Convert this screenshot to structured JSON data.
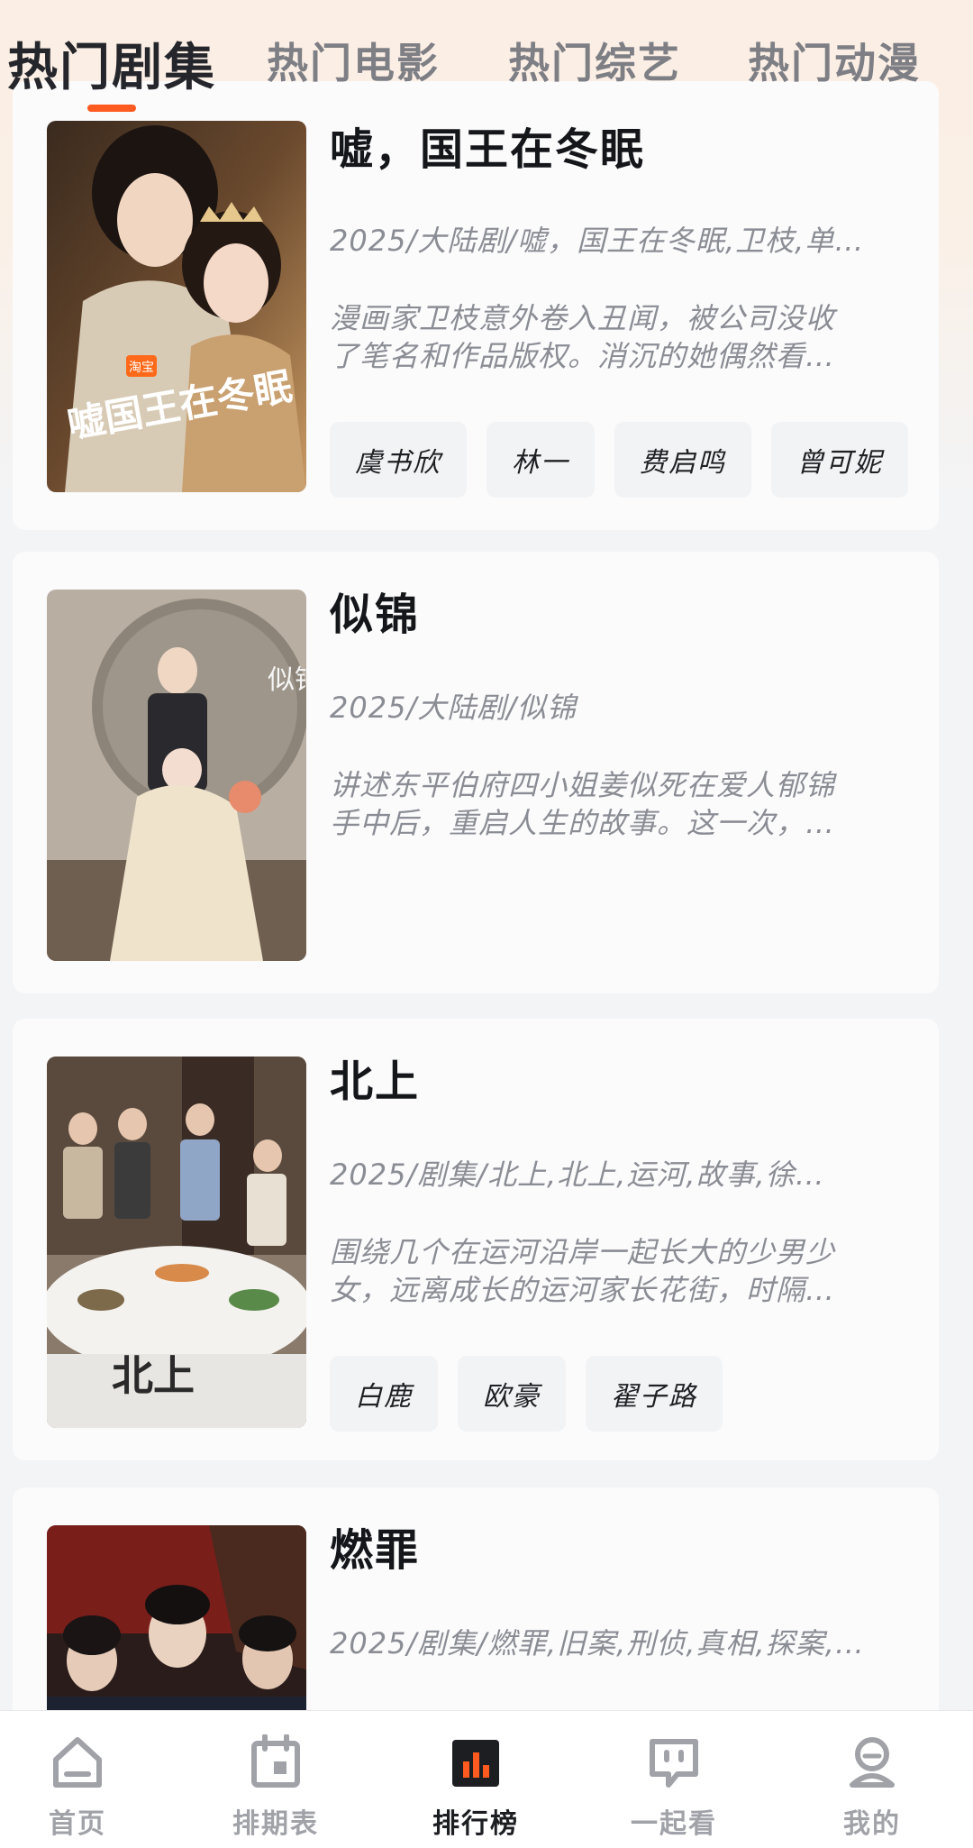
{
  "tabs": [
    {
      "label": "热门剧集",
      "active": true
    },
    {
      "label": "热门电影",
      "active": false
    },
    {
      "label": "热门综艺",
      "active": false
    },
    {
      "label": "热门动漫",
      "active": false
    }
  ],
  "cards": [
    {
      "title": "嘘，国王在冬眠",
      "meta": "2025/大陆剧/嘘，国王在冬眠,卫枝,单…",
      "desc_line1": "漫画家卫枝意外卷入丑闻，被公司没收",
      "desc_line2": "了笔名和作品版权。消沉的她偶然看…",
      "tags": [
        "虞书欣",
        "林一",
        "费启鸣",
        "曾可妮"
      ],
      "poster_text": "嘘国王在冬眠",
      "poster_badge": "淘宝"
    },
    {
      "title": "似锦",
      "meta": "2025/大陆剧/似锦",
      "desc_line1": "讲述东平伯府四小姐姜似死在爱人郁锦",
      "desc_line2": "手中后，重启人生的故事。这一次，…",
      "tags": [],
      "poster_text": "似锦"
    },
    {
      "title": "北上",
      "meta": "2025/剧集/北上,北上,运河,故事,徐…",
      "desc_line1": "围绕几个在运河沿岸一起长大的少男少",
      "desc_line2": "女，远离成长的运河家长花街，时隔…",
      "tags": [
        "白鹿",
        "欧豪",
        "翟子路"
      ],
      "poster_text": "北上"
    },
    {
      "title": "燃罪",
      "meta": "2025/剧集/燃罪,旧案,刑侦,真相,探案,…",
      "desc_line1": "",
      "desc_line2": "",
      "tags": []
    }
  ],
  "nav": [
    {
      "label": "首页",
      "icon": "home-icon",
      "active": false
    },
    {
      "label": "排期表",
      "icon": "calendar-icon",
      "active": false
    },
    {
      "label": "排行榜",
      "icon": "ranking-chart-icon",
      "active": true
    },
    {
      "label": "一起看",
      "icon": "chat-bubble-icon",
      "active": false
    },
    {
      "label": "我的",
      "icon": "profile-icon",
      "active": false
    }
  ],
  "colors": {
    "accent": "#ff5a1f",
    "text_primary": "#15161a",
    "text_secondary": "#8b8d94",
    "nav_inactive": "#a0a2a8"
  }
}
